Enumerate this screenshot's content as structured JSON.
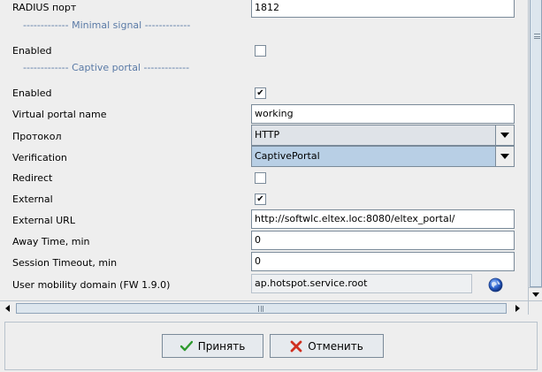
{
  "fields": {
    "radius_port": {
      "label": "RADIUS порт",
      "value": "1812"
    },
    "section_minimal_signal": "------------- Minimal signal -------------",
    "minimal_enabled": {
      "label": "Enabled",
      "checked": false
    },
    "section_captive_portal": "------------- Captive portal -------------",
    "captive_enabled": {
      "label": "Enabled",
      "checked": true,
      "mark": "✔"
    },
    "virtual_portal_name": {
      "label": "Virtual portal name",
      "value": "working"
    },
    "protocol": {
      "label": "Протокол",
      "value": "HTTP"
    },
    "verification": {
      "label": "Verification",
      "value": "CaptivePortal"
    },
    "redirect": {
      "label": "Redirect",
      "checked": false
    },
    "external": {
      "label": "External",
      "checked": true,
      "mark": "✔"
    },
    "external_url": {
      "label": "External URL",
      "value": "http://softwlc.eltex.loc:8080/eltex_portal/"
    },
    "away_time": {
      "label": "Away Time, min",
      "value": "0"
    },
    "session_timeout": {
      "label": "Session Timeout, min",
      "value": "0"
    },
    "user_mobility_domain": {
      "label": "User mobility domain (FW 1.9.0)",
      "value": "ap.hotspot.service.root"
    }
  },
  "buttons": {
    "accept": "Принять",
    "cancel": "Отменить"
  },
  "icons": {
    "dropdown": "chevron-down-icon",
    "globe": "globe-icon",
    "accept": "check-icon",
    "cancel": "x-icon"
  },
  "colors": {
    "section_text": "#5a7aa6",
    "selected_combo": "#b8cfe5",
    "accept_icon": "#2e9a2e",
    "cancel_icon": "#d03020"
  }
}
